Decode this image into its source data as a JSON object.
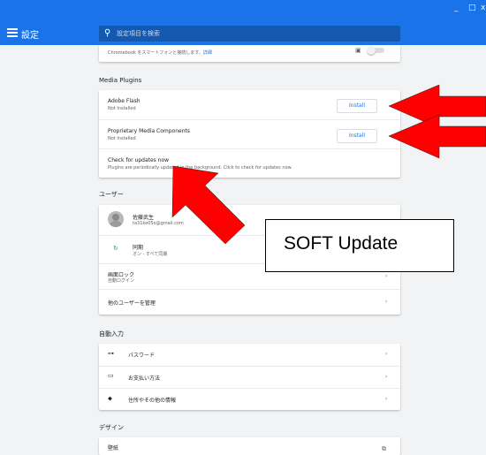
{
  "window": {
    "minimize_label": "_",
    "maximize_label": "□",
    "close_label": "x"
  },
  "header": {
    "title": "設定",
    "search_placeholder": "設定項目を検索"
  },
  "top_partial": {
    "text": "Chromebook をスマートフォンと接続します。",
    "link": "詳細"
  },
  "media_plugins": {
    "heading": "Media Plugins",
    "items": [
      {
        "name": "Adobe Flash",
        "status": "Not Installed",
        "button": "Install"
      },
      {
        "name": "Proprietary Media Components",
        "status": "Not Installed",
        "button": "Install"
      }
    ],
    "updates_title": "Check for updates now",
    "updates_desc": "Plugins are periodically updated in the background. Click to check for updates now."
  },
  "users": {
    "heading": "ユーザー",
    "account_name": "佐藤武生",
    "account_email": "ta31ke05o@gmail.com",
    "sync_title": "同期",
    "sync_status": "オン - すべて同期",
    "lock_title": "画面ロック",
    "lock_sub": "自動ログイン",
    "manage": "他のユーザーを管理"
  },
  "autofill": {
    "heading": "自動入力",
    "items": [
      {
        "icon": "key-icon",
        "glyph": "⊶",
        "label": "パスワード"
      },
      {
        "icon": "credit-card-icon",
        "glyph": "▭",
        "label": "お支払い方法"
      },
      {
        "icon": "location-pin-icon",
        "glyph": "⬥",
        "label": "住所やその他の情報"
      }
    ]
  },
  "design": {
    "heading": "デザイン",
    "wallpaper": "壁紙"
  },
  "annotation": {
    "callout_text": "SOFT Update",
    "arrow_color": "#ff0000"
  },
  "colors": {
    "accent": "#1a73e8",
    "background": "#f1f3f4"
  }
}
